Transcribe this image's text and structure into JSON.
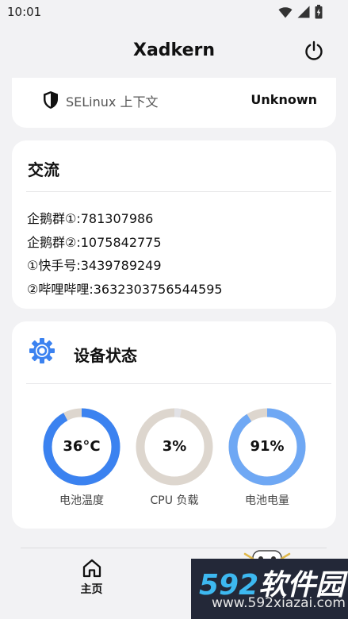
{
  "status_bar": {
    "time": "10:01",
    "icons": [
      "wifi-icon",
      "signal-icon",
      "battery-icon"
    ]
  },
  "app_bar": {
    "title": "Xadkern",
    "action_icon": "power-icon"
  },
  "selinux": {
    "icon": "shield-icon",
    "label": "SELinux 上下文",
    "value": "Unknown"
  },
  "community": {
    "title": "交流",
    "lines": [
      "企鹅群①:781307986",
      "企鹅群②:1075842775",
      "①快手号:3439789249",
      "②哔哩哔哩:3632303756544595"
    ]
  },
  "device": {
    "icon": "gear-icon",
    "title": "设备状态",
    "gauges": [
      {
        "value_text": "36°C",
        "label": "电池温度",
        "fraction": 0.92,
        "color": "#3b82f0",
        "track": "#ddd6ce"
      },
      {
        "value_text": "3%",
        "label": "CPU 负载",
        "fraction": 0.03,
        "color": "#e2e2e6",
        "track": "#ddd6ce"
      },
      {
        "value_text": "91%",
        "label": "电池电量",
        "fraction": 0.91,
        "color": "#6fa8f4",
        "track": "#ddd6ce"
      }
    ]
  },
  "bottom_nav": {
    "items": [
      {
        "label": "主页",
        "icon": "home-icon",
        "active": true
      },
      {
        "label": "",
        "icon": "mascot-icon",
        "active": false
      }
    ]
  },
  "watermark": {
    "brand_num": "592",
    "brand_cn": "软件园",
    "url": "www.592xiazai.com"
  },
  "colors": {
    "background": "#f2f2f4",
    "card": "#ffffff",
    "accent": "#3b82f0",
    "gauge_track": "#ddd6ce"
  }
}
